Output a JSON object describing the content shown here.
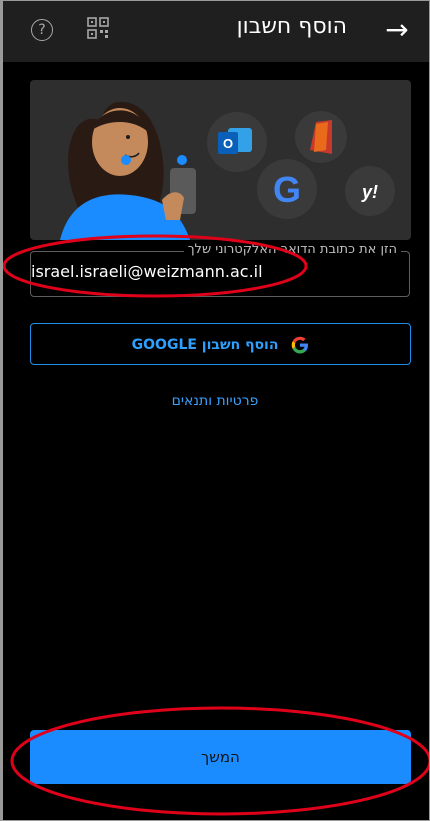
{
  "header": {
    "title": "הוסף חשבון",
    "back_icon": "arrow-right-icon",
    "help_icon": "question-circle-icon",
    "qr_icon": "qr-code-icon"
  },
  "hero": {
    "icons": [
      "outlook-icon",
      "office-icon",
      "google-icon",
      "yahoo-icon"
    ],
    "outlook_letter": "O",
    "yahoo_text": "y!",
    "google_letter": "G"
  },
  "email": {
    "label": "הזן את כתובת הדואר האלקטרוני שלך",
    "value": "israel.israeli@weizmann.ac.il"
  },
  "google_button": {
    "label": "הוסף חשבון GOOGLE"
  },
  "privacy_link": {
    "label": "פרטיות ותנאים"
  },
  "continue_button": {
    "label": "המשך"
  },
  "colors": {
    "accent": "#1a8cff",
    "annotation": "#e0001a",
    "background": "#000000",
    "appbar": "#1f1f1f"
  }
}
